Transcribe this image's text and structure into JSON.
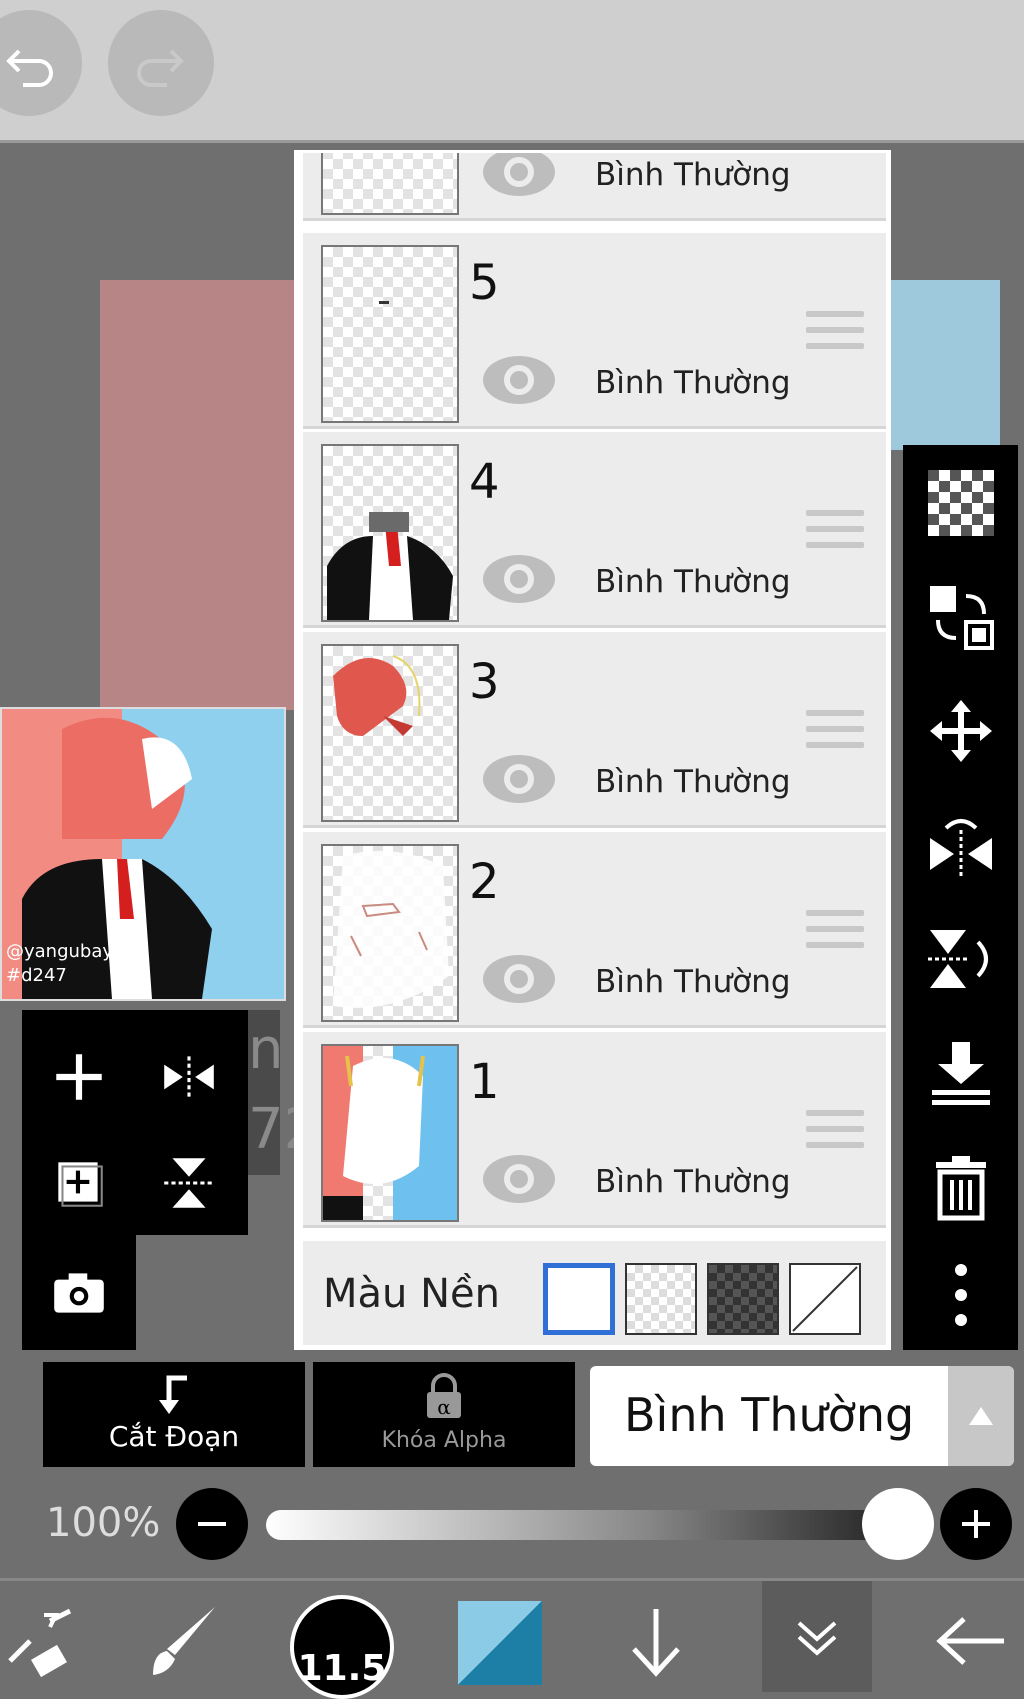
{
  "toolbar": {
    "undo": "undo-icon",
    "redo": "redo-icon"
  },
  "layers": [
    {
      "num": "",
      "mode": "Bình Thường"
    },
    {
      "num": "5",
      "mode": "Bình Thường"
    },
    {
      "num": "4",
      "mode": "Bình Thường"
    },
    {
      "num": "3",
      "mode": "Bình Thường"
    },
    {
      "num": "2",
      "mode": "Bình Thường"
    },
    {
      "num": "1",
      "mode": "Bình Thường"
    }
  ],
  "background": {
    "label": "Màu Nền"
  },
  "canvas": {
    "watermark_1": "@yangubay",
    "watermark_2": "#d247",
    "fragment": "n\n72"
  },
  "actions": {
    "clip_label": "Cắt Đoạn",
    "alpha_label": "Khóa Alpha"
  },
  "blend": {
    "mode": "Bình Thường"
  },
  "opacity": {
    "label": "100%",
    "value": 1.0
  },
  "brush": {
    "size": "11.5"
  },
  "colors": {
    "primary": "#1e7fa6",
    "panel": "#ececec",
    "accent_selected": "#2f6fd6"
  }
}
